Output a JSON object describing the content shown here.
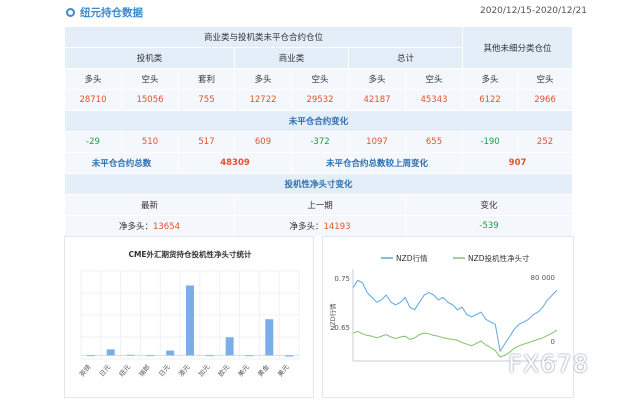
{
  "header": {
    "title": "纽元持仓数据",
    "date_range": "2020/12/15-2020/12/21"
  },
  "table": {
    "section1_title": "商业类与投机类未平仓合约仓位",
    "other_title": "其他未细分类仓位",
    "groups": {
      "spec": "投机类",
      "comm": "商业类",
      "total": "总计"
    },
    "cols": {
      "long": "多头",
      "short": "空头",
      "spread": "套利"
    },
    "values": {
      "spec_long": "28710",
      "spec_short": "15056",
      "spec_spread": "755",
      "comm_long": "12722",
      "comm_short": "29532",
      "total_long": "42187",
      "total_short": "45343",
      "other_long": "6122",
      "other_short": "2966"
    },
    "changes_title": "未平仓合约变化",
    "changes": [
      "-29",
      "510",
      "517",
      "609",
      "-372",
      "1097",
      "655",
      "-190",
      "252"
    ],
    "oi_total_label": "未平仓合约总数",
    "oi_total": "48309",
    "oi_change_label": "未平仓合约总数较上周变化",
    "oi_change": "907",
    "net_title": "投机性净头寸变化",
    "net_cols": {
      "latest": "最新",
      "prev": "上一期",
      "change": "变化"
    },
    "net_latest_label": "净多头：",
    "net_latest": "13654",
    "net_prev_label": "净多头：",
    "net_prev": "14193",
    "net_change": "-539"
  },
  "watermark": "FX678",
  "chart_data": [
    {
      "type": "bar",
      "title": "CME外汇期货持仓投机性净头寸统计",
      "categories": [
        "英镑",
        "日元",
        "纽元",
        "瑞郎",
        "日元",
        "澳元",
        "加元",
        "欧元",
        "美元",
        "黄金",
        "美元"
      ],
      "values": [
        0,
        5,
        0.5,
        0,
        4,
        58,
        0,
        15,
        0,
        30,
        -1
      ],
      "ylim": [
        -3,
        70
      ],
      "grid": true,
      "colors": {
        "bar": "#7aaee6"
      }
    },
    {
      "type": "line",
      "legend_position": "top",
      "series": [
        {
          "name": "NZD行情",
          "axis": "left",
          "color": "#5aa9e6",
          "values": [
            0.73,
            0.745,
            0.74,
            0.72,
            0.71,
            0.7,
            0.705,
            0.715,
            0.7,
            0.695,
            0.7,
            0.71,
            0.69,
            0.685,
            0.7,
            0.715,
            0.72,
            0.715,
            0.705,
            0.71,
            0.7,
            0.695,
            0.685,
            0.69,
            0.675,
            0.67,
            0.675,
            0.68,
            0.665,
            0.66,
            0.655,
            0.6,
            0.615,
            0.63,
            0.645,
            0.655,
            0.66,
            0.665,
            0.675,
            0.68,
            0.69,
            0.705,
            0.715,
            0.725
          ]
        },
        {
          "name": "NZD投机性净头寸",
          "axis": "right",
          "color": "#7fc46a",
          "values": [
            10000,
            12000,
            9000,
            7000,
            6000,
            4000,
            6000,
            8000,
            5000,
            3000,
            5000,
            6000,
            2000,
            4000,
            8000,
            10000,
            9000,
            7000,
            6000,
            4000,
            3000,
            2000,
            1000,
            -2000,
            -4000,
            -6000,
            -3000,
            0,
            -5000,
            -8000,
            -12000,
            -20000,
            -18000,
            -14000,
            -9000,
            -6000,
            -4000,
            -2000,
            0,
            2000,
            4000,
            7000,
            10000,
            13654
          ]
        }
      ],
      "y_left": {
        "label": "NZD行情",
        "ticks": [
          "0.75",
          "0.65"
        ],
        "range": [
          0.58,
          0.76
        ]
      },
      "y_right": {
        "ticks": [
          "80 000",
          "0"
        ],
        "range": [
          -25000,
          85000
        ]
      }
    }
  ]
}
